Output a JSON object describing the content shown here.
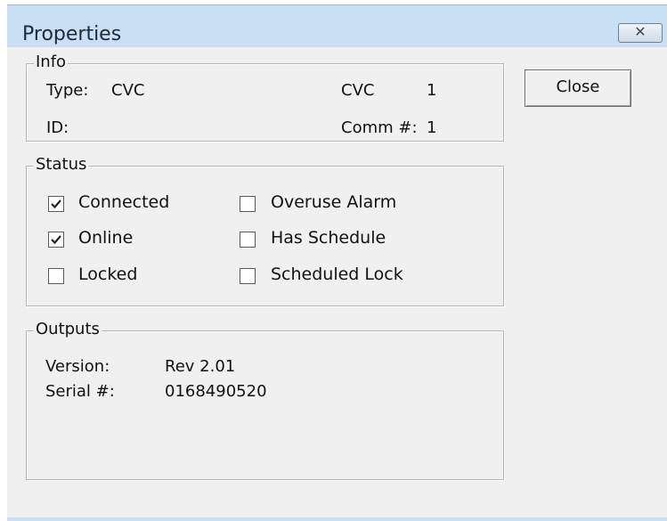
{
  "window": {
    "title": "Properties",
    "close_icon_glyph": "✕"
  },
  "info": {
    "label": "Info",
    "type_label": "Type:",
    "type_value": "CVC",
    "cvc_label": "CVC",
    "cvc_value": "1",
    "id_label": "ID:",
    "id_value": "",
    "comm_label": "Comm #:",
    "comm_value": "1"
  },
  "status": {
    "label": "Status",
    "items": [
      {
        "label": "Connected",
        "checked": true
      },
      {
        "label": "Online",
        "checked": true
      },
      {
        "label": "Locked",
        "checked": false
      },
      {
        "label": "Overuse Alarm",
        "checked": false
      },
      {
        "label": "Has Schedule",
        "checked": false
      },
      {
        "label": "Scheduled Lock",
        "checked": false
      }
    ]
  },
  "outputs": {
    "label": "Outputs",
    "version_label": "Version:",
    "version_value": "Rev 2.01",
    "serial_label": "Serial #:",
    "serial_value": "0168490520"
  },
  "buttons": {
    "close_label": "Close"
  },
  "colors": {
    "titlebar": "#c9dff4",
    "client": "#f0f0f0"
  }
}
